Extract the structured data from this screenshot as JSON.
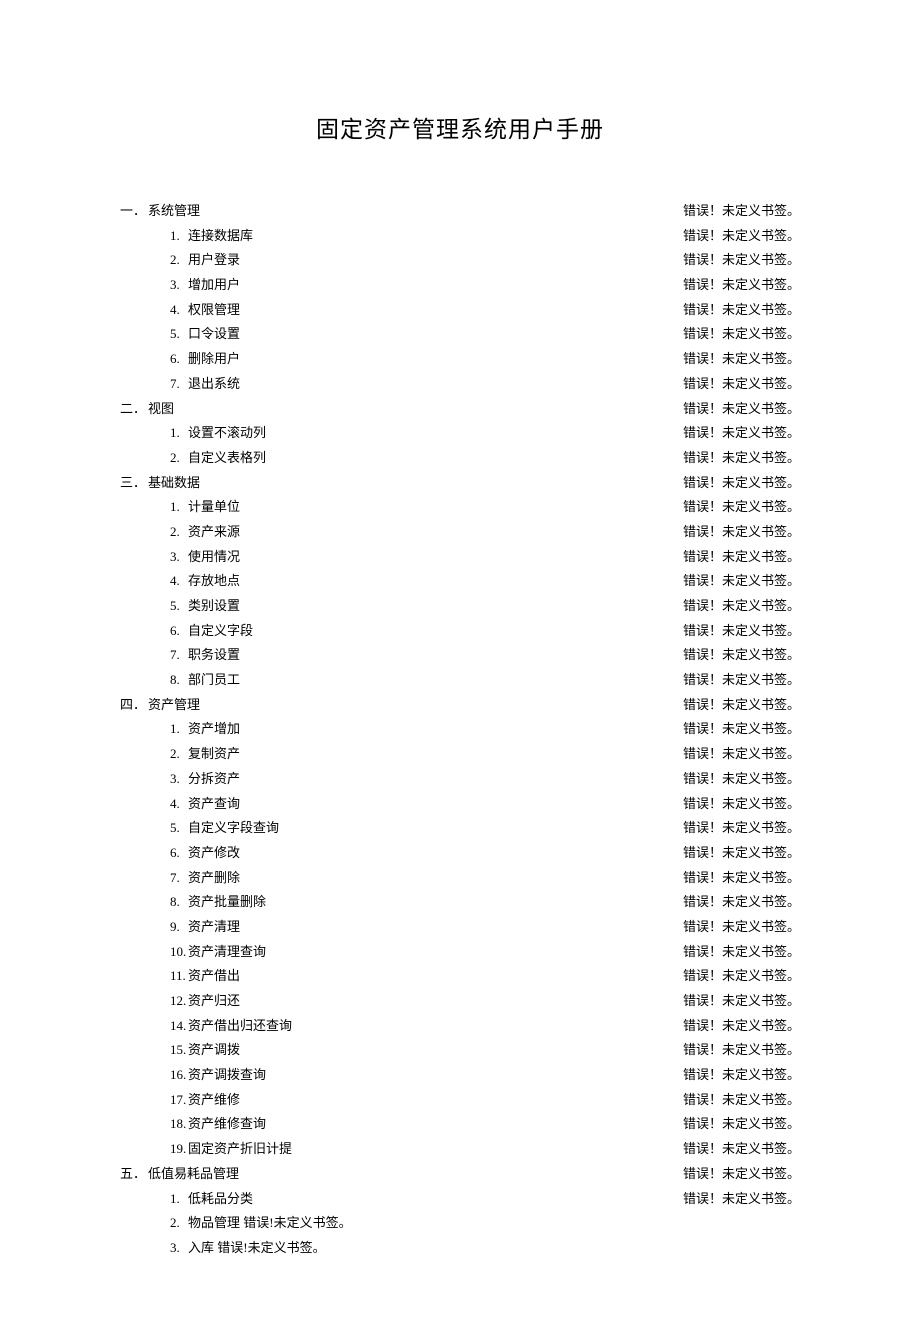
{
  "title": "固定资产管理系统用户手册",
  "error_text": "错误！未定义书签。",
  "inline_error_text": "错误!未定义书签。",
  "sections": [
    {
      "marker": "一．",
      "label": "系统管理",
      "items": [
        {
          "marker": "1.",
          "label": "连接数据库"
        },
        {
          "marker": "2.",
          "label": "用户登录"
        },
        {
          "marker": "3.",
          "label": "增加用户"
        },
        {
          "marker": "4.",
          "label": "权限管理"
        },
        {
          "marker": "5.",
          "label": "口令设置"
        },
        {
          "marker": "6.",
          "label": "删除用户"
        },
        {
          "marker": "7.",
          "label": "退出系统"
        }
      ]
    },
    {
      "marker": "二．",
      "label": "视图",
      "items": [
        {
          "marker": "1.",
          "label": "设置不滚动列"
        },
        {
          "marker": "2.",
          "label": "自定义表格列"
        }
      ]
    },
    {
      "marker": "三．",
      "label": "基础数据",
      "items": [
        {
          "marker": "1.",
          "label": "计量单位"
        },
        {
          "marker": "2.",
          "label": "资产来源"
        },
        {
          "marker": "3.",
          "label": "使用情况"
        },
        {
          "marker": "4.",
          "label": "存放地点"
        },
        {
          "marker": "5.",
          "label": "类别设置"
        },
        {
          "marker": "6.",
          "label": "自定义字段"
        },
        {
          "marker": "7.",
          "label": "职务设置"
        },
        {
          "marker": "8.",
          "label": "部门员工"
        }
      ]
    },
    {
      "marker": "四．",
      "label": "资产管理",
      "items": [
        {
          "marker": "1.",
          "label": "资产增加"
        },
        {
          "marker": "2.",
          "label": "复制资产"
        },
        {
          "marker": "3.",
          "label": "分拆资产"
        },
        {
          "marker": "4.",
          "label": "资产查询"
        },
        {
          "marker": "5.",
          "label": "自定义字段查询"
        },
        {
          "marker": "6.",
          "label": "资产修改"
        },
        {
          "marker": "7.",
          "label": "资产删除"
        },
        {
          "marker": "8.",
          "label": "资产批量删除"
        },
        {
          "marker": "9.",
          "label": "资产清理"
        },
        {
          "marker": "10.",
          "label": "资产清理查询"
        },
        {
          "marker": "11.",
          "label": "资产借出"
        },
        {
          "marker": "12.",
          "label": "资产归还"
        },
        {
          "marker": "14.",
          "label": "资产借出归还查询"
        },
        {
          "marker": "15.",
          "label": "资产调拨"
        },
        {
          "marker": "16.",
          "label": "资产调拨查询"
        },
        {
          "marker": "17.",
          "label": "资产维修"
        },
        {
          "marker": "18.",
          "label": "资产维修查询"
        },
        {
          "marker": "19.",
          "label": "固定资产折旧计提"
        }
      ]
    },
    {
      "marker": "五．",
      "label": "低值易耗品管理",
      "items": [
        {
          "marker": "1.",
          "label": "低耗品分类"
        },
        {
          "marker": "2.",
          "label": "物品管理",
          "inline_error": true
        },
        {
          "marker": "3.",
          "label": "入库",
          "inline_error": true
        }
      ]
    }
  ],
  "right_error_count": 41
}
